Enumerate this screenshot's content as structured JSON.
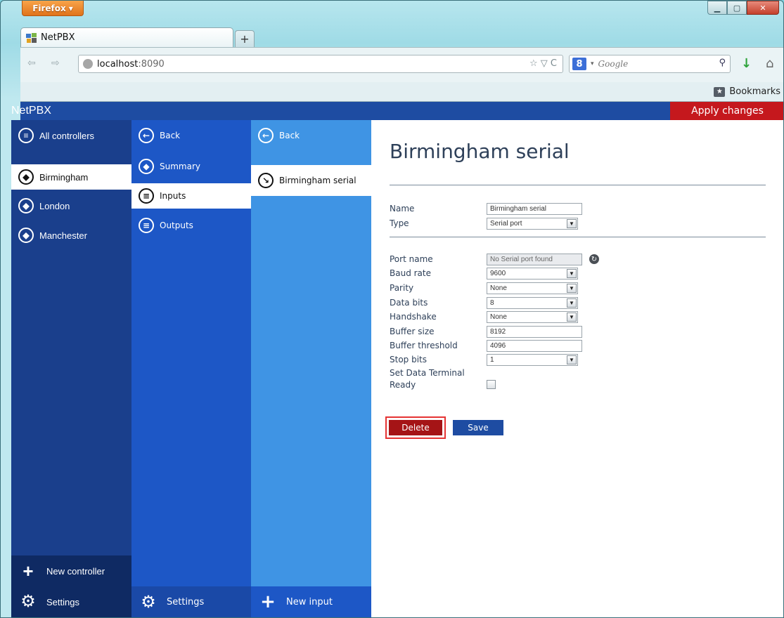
{
  "browser": {
    "menu_label": "Firefox",
    "tab_title": "NetPBX",
    "new_tab": "+",
    "url_host": "localhost",
    "url_port": ":8090",
    "search_placeholder": "Google",
    "bookmarks_label": "Bookmarks"
  },
  "app": {
    "title": "NetPBX",
    "apply_label": "Apply changes"
  },
  "col1": {
    "header": "All controllers",
    "items": [
      {
        "label": "Birmingham",
        "selected": true
      },
      {
        "label": "London"
      },
      {
        "label": "Manchester"
      }
    ],
    "new_label": "New controller",
    "settings_label": "Settings"
  },
  "col2": {
    "back_label": "Back",
    "items": [
      {
        "label": "Summary"
      },
      {
        "label": "Inputs",
        "selected": true
      },
      {
        "label": "Outputs"
      }
    ],
    "settings_label": "Settings"
  },
  "col3": {
    "back_label": "Back",
    "items": [
      {
        "label": "Birmingham serial",
        "selected": true
      }
    ],
    "new_label": "New input"
  },
  "content": {
    "title": "Birmingham serial",
    "name_label": "Name",
    "name_value": "Birmingham serial",
    "type_label": "Type",
    "type_value": "Serial port",
    "port_label": "Port name",
    "port_value": "No Serial port found",
    "baud_label": "Baud rate",
    "baud_value": "9600",
    "parity_label": "Parity",
    "parity_value": "None",
    "databits_label": "Data bits",
    "databits_value": "8",
    "handshake_label": "Handshake",
    "handshake_value": "None",
    "buffer_label": "Buffer size",
    "buffer_value": "8192",
    "threshold_label": "Buffer threshold",
    "threshold_value": "4096",
    "stopbits_label": "Stop bits",
    "stopbits_value": "1",
    "dtr_label_1": "Set Data Terminal",
    "dtr_label_2": "Ready",
    "delete_label": "Delete",
    "save_label": "Save"
  }
}
